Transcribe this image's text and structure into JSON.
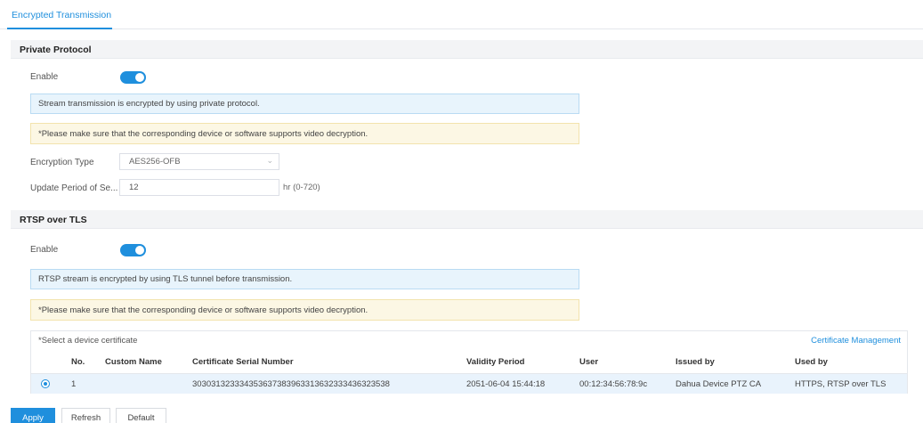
{
  "tabs": [
    {
      "label": "Encrypted Transmission"
    }
  ],
  "private_protocol": {
    "title": "Private Protocol",
    "enable_label": "Enable",
    "enabled": true,
    "info_note": "Stream transmission is encrypted by using private protocol.",
    "warning_note": "*Please make sure that the corresponding device or software supports video decryption.",
    "encryption_type_label": "Encryption Type",
    "encryption_type_value": "AES256-OFB",
    "update_period_label": "Update Period of Se...",
    "update_period_value": "12",
    "update_period_unit": "hr (0-720)"
  },
  "rtsp_over_tls": {
    "title": "RTSP over TLS",
    "enable_label": "Enable",
    "enabled": true,
    "info_note": "RTSP stream is encrypted by using TLS tunnel before transmission.",
    "warning_note": "*Please make sure that the corresponding device or software supports video decryption.",
    "certificate_section_label": "*Select a device certificate",
    "certificate_management_link": "Certificate Management",
    "table": {
      "columns": [
        "No.",
        "Custom Name",
        "Certificate Serial Number",
        "Validity Period",
        "User",
        "Issued by",
        "Used by"
      ],
      "rows": [
        {
          "selected": true,
          "no": "1",
          "custom_name": "",
          "serial_number": "303031323334353637383963313632333436323538",
          "validity_period": "2051-06-04 15:44:18",
          "user": "00:12:34:56:78:9c",
          "issued_by": "Dahua Device PTZ CA",
          "used_by": "HTTPS, RTSP over TLS"
        }
      ]
    }
  },
  "buttons": {
    "apply": "Apply",
    "refresh": "Refresh",
    "default": "Default"
  },
  "colors": {
    "accent": "#1f8fdd",
    "info_bg": "#e8f4fc",
    "warning_bg": "#fcf7e4"
  }
}
